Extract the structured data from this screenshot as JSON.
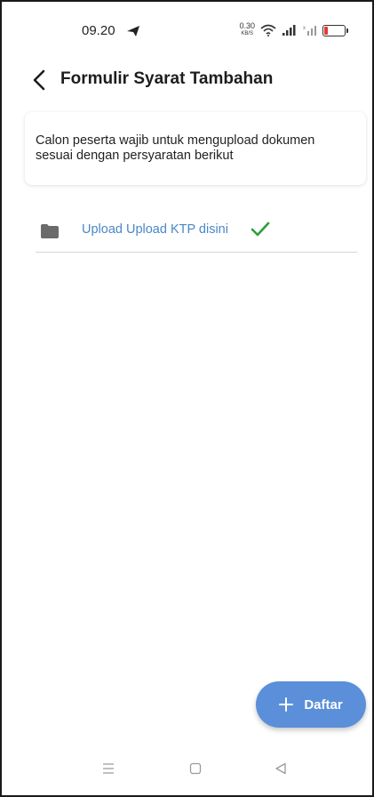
{
  "status_bar": {
    "time": "09.20",
    "speed_value": "0.30",
    "speed_unit": "KB/S",
    "battery_level": "19",
    "battery_fraction": 0.19,
    "battery_color": "#e53935"
  },
  "app_bar": {
    "title": "Formulir Syarat Tambahan",
    "back_icon": "chevron-left-icon"
  },
  "info_card": {
    "text": "Calon peserta wajib untuk mengupload dokumen sesuai dengan persyaratan berikut"
  },
  "uploads": [
    {
      "label": "Upload Upload KTP disini",
      "icon": "folder-icon",
      "status_icon": "check-icon",
      "uploaded": true
    }
  ],
  "fab": {
    "label": "Daftar",
    "icon": "plus-icon"
  },
  "colors": {
    "accent": "#5b8fd9",
    "link": "#4a86c8",
    "success": "#2e9e3a",
    "folder": "#6b6b6b"
  },
  "nav_bar": {
    "items": [
      "menu-icon",
      "home-icon",
      "back-icon"
    ]
  }
}
